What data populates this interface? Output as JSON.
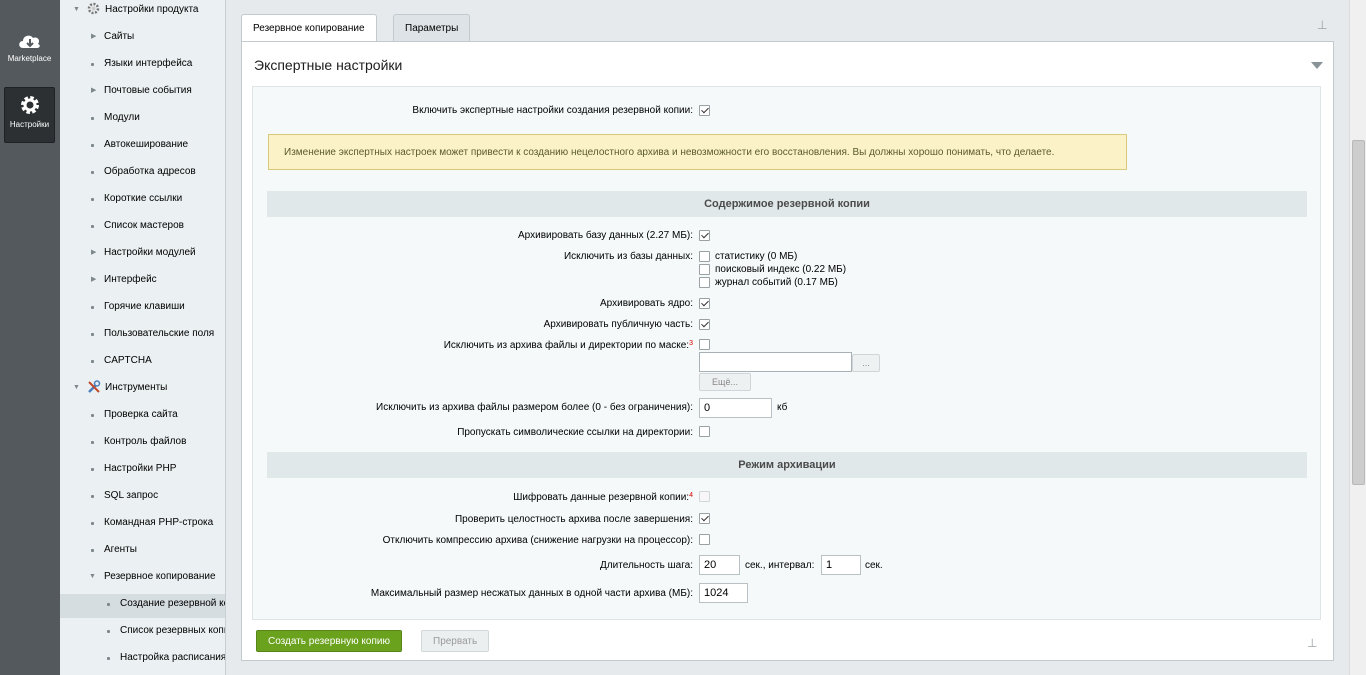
{
  "leftbar": {
    "marketplace_label": "Marketplace",
    "settings_label": "Настройки"
  },
  "menu": {
    "items": [
      {
        "label": "Настройки продукта",
        "type": "group"
      },
      {
        "label": "Сайты",
        "type": "arrow"
      },
      {
        "label": "Языки интерфейса",
        "type": "dot"
      },
      {
        "label": "Почтовые события",
        "type": "arrow"
      },
      {
        "label": "Модули",
        "type": "dot"
      },
      {
        "label": "Автокеширование",
        "type": "dot"
      },
      {
        "label": "Обработка адресов",
        "type": "dot"
      },
      {
        "label": "Короткие ссылки",
        "type": "dot"
      },
      {
        "label": "Список мастеров",
        "type": "dot"
      },
      {
        "label": "Настройки модулей",
        "type": "arrow"
      },
      {
        "label": "Интерфейс",
        "type": "arrow"
      },
      {
        "label": "Горячие клавиши",
        "type": "dot"
      },
      {
        "label": "Пользовательские поля",
        "type": "dot"
      },
      {
        "label": "CAPTCHA",
        "type": "dot"
      },
      {
        "label": "Инструменты",
        "type": "group"
      },
      {
        "label": "Проверка сайта",
        "type": "dot"
      },
      {
        "label": "Контроль файлов",
        "type": "dot"
      },
      {
        "label": "Настройки PHP",
        "type": "dot"
      },
      {
        "label": "SQL запрос",
        "type": "dot"
      },
      {
        "label": "Командная PHP-строка",
        "type": "dot"
      },
      {
        "label": "Агенты",
        "type": "dot"
      },
      {
        "label": "Резервное копирование",
        "type": "open"
      },
      {
        "label": "Создание резервной копии",
        "type": "sub",
        "selected": true
      },
      {
        "label": "Список резервных копий",
        "type": "sub"
      },
      {
        "label": "Настройка расписания",
        "type": "sub"
      }
    ]
  },
  "tabs": [
    {
      "label": "Резервное копирование"
    },
    {
      "label": "Параметры"
    }
  ],
  "panel": {
    "title": "Экспертные настройки"
  },
  "form": {
    "expert_label": "Включить экспертные настройки создания резервной копии:",
    "warning": "Изменение экспертных настроек может привести к созданию нецелостного архива и невозможности его восстановления. Вы должны хорошо понимать, что делаете.",
    "section_content": "Содержимое резервной копии",
    "archive_db_label": "Архивировать базу данных (2.27 МБ):",
    "exclude_db_label": "Исключить из базы данных:",
    "exclude_stats": "статистику (0 МБ)",
    "exclude_search": "поисковый индекс (0.22 МБ)",
    "exclude_log": "журнал событий (0.17 МБ)",
    "archive_core_label": "Архивировать ядро:",
    "archive_public_label": "Архивировать публичную часть:",
    "exclude_mask_label": "Исключить из архива файлы и директории по маске:",
    "exclude_mask_sup": "3",
    "browse_label": "...",
    "more_label": "Ещё...",
    "exclude_size_label": "Исключить из архива файлы размером более (0 - без ограничения):",
    "exclude_size_value": "0",
    "exclude_size_unit": "кб",
    "skip_symlinks_label": "Пропускать символические ссылки на директории:",
    "section_mode": "Режим архивации",
    "encrypt_label": "Шифровать данные резервной копии:",
    "encrypt_sup": "4",
    "check_integrity_label": "Проверить целостность архива после завершения:",
    "disable_compress_label": "Отключить компрессию архива (снижение нагрузки на процессор):",
    "step_label": "Длительность шага:",
    "step_value": "20",
    "interval_label": "сек., интервал:",
    "interval_value": "1",
    "interval_unit": "сек.",
    "max_size_label": "Максимальный размер несжатых данных в одной части архива (МБ):",
    "max_size_value": "1024"
  },
  "buttons": {
    "create": "Создать резервную копию",
    "abort": "Прервать"
  },
  "colors": {
    "accent_green": "#6ba21d",
    "warning_bg": "#fbf3c7"
  }
}
